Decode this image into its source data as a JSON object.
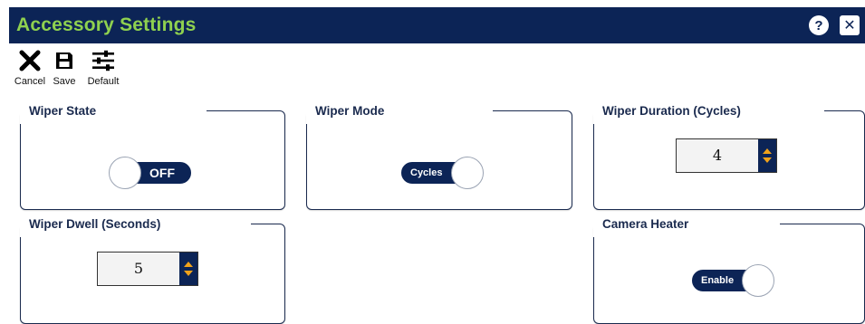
{
  "window": {
    "title": "Accessory Settings",
    "help_glyph": "?",
    "close_glyph": "✕"
  },
  "toolbar": {
    "cancel_label": "Cancel",
    "save_label": "Save",
    "default_label": "Default"
  },
  "panels": {
    "wiper_state": {
      "title": "Wiper State",
      "toggle_text": "OFF"
    },
    "wiper_mode": {
      "title": "Wiper Mode",
      "toggle_text": "Cycles"
    },
    "wiper_duration": {
      "title": "Wiper Duration (Cycles)",
      "value": "4"
    },
    "wiper_dwell": {
      "title": "Wiper Dwell (Seconds)",
      "value": "5"
    },
    "camera_heater": {
      "title": "Camera Heater",
      "toggle_text": "Enable"
    }
  },
  "colors": {
    "header_bg": "#0c2456",
    "title_text": "#8fd14f",
    "spinner_arrow": "#f0a21a"
  },
  "icons": [
    "close-x-icon",
    "save-disk-icon",
    "sliders-icon",
    "help-icon",
    "close-icon"
  ]
}
